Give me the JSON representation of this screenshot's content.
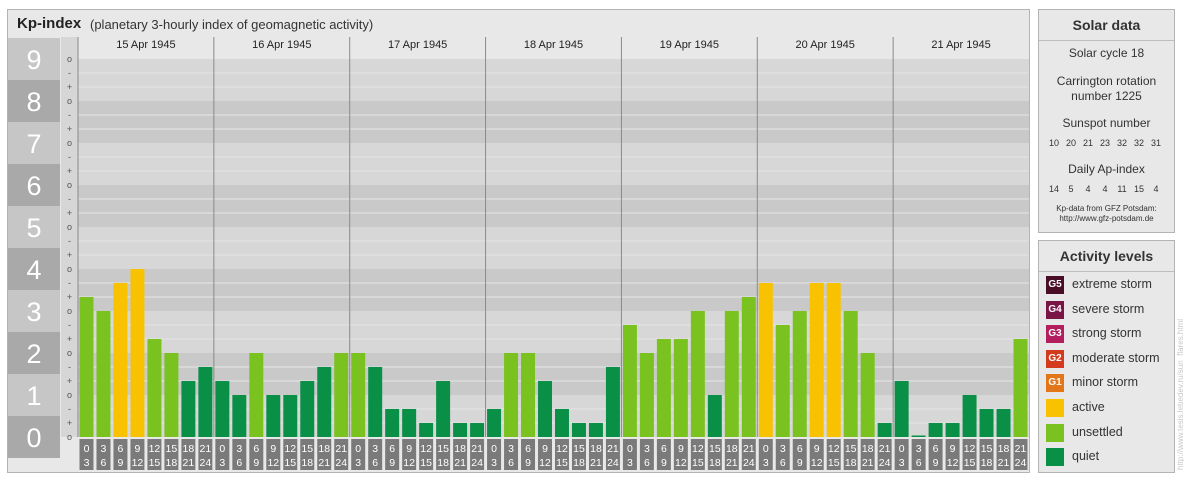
{
  "header": {
    "title": "Kp-index",
    "subtitle": "(planetary 3-hourly index of geomagnetic activity)"
  },
  "chart_data": {
    "type": "bar",
    "ylim": [
      0,
      9
    ],
    "ytick_labels": [
      "0",
      "1",
      "2",
      "3",
      "4",
      "5",
      "6",
      "7",
      "8",
      "9"
    ],
    "minor_tick_labels": [
      "o",
      "+",
      "-"
    ],
    "days": [
      "15 Apr 1945",
      "16 Apr 1945",
      "17 Apr 1945",
      "18 Apr 1945",
      "19 Apr 1945",
      "20 Apr 1945",
      "21 Apr 1945"
    ],
    "hour_labels": [
      [
        "0",
        "3"
      ],
      [
        "3",
        "6"
      ],
      [
        "6",
        "9"
      ],
      [
        "9",
        "12"
      ],
      [
        "12",
        "15"
      ],
      [
        "15",
        "18"
      ],
      [
        "18",
        "21"
      ],
      [
        "21",
        "24"
      ]
    ],
    "values": [
      3.333,
      3.0,
      3.667,
      4.0,
      2.333,
      2.0,
      1.333,
      1.667,
      1.333,
      1.0,
      2.0,
      1.0,
      1.0,
      1.333,
      1.667,
      2.0,
      2.0,
      1.667,
      0.667,
      0.667,
      0.333,
      1.333,
      0.333,
      0.333,
      0.667,
      2.0,
      2.0,
      1.333,
      0.667,
      0.333,
      0.333,
      1.667,
      2.667,
      2.0,
      2.333,
      2.333,
      3.0,
      1.0,
      3.0,
      3.333,
      3.667,
      2.667,
      3.0,
      3.667,
      3.667,
      3.0,
      2.0,
      0.333,
      1.333,
      0.0,
      0.333,
      0.333,
      1.0,
      0.667,
      0.667,
      2.333
    ],
    "level_colors": {
      "quiet": "#0a8f47",
      "unsettled": "#7ac21f",
      "active": "#f8c200"
    },
    "grid": true
  },
  "solar": {
    "title": "Solar data",
    "cycle": "Solar cycle 18",
    "carrington_line1": "Carrington rotation",
    "carrington_line2": "number 1225",
    "sunspot_label": "Sunspot number",
    "sunspot_values": [
      "10",
      "20",
      "21",
      "23",
      "32",
      "32",
      "31"
    ],
    "ap_label": "Daily Ap-index",
    "ap_values": [
      "14",
      "5",
      "4",
      "4",
      "11",
      "15",
      "4"
    ],
    "source_line1": "Kp-data from GFZ Potsdam:",
    "source_line2": "http://www.gfz-potsdam.de"
  },
  "activity": {
    "title": "Activity levels",
    "items": [
      {
        "code": "G5",
        "label": "extreme storm",
        "color": "#4a0d26"
      },
      {
        "code": "G4",
        "label": "severe storm",
        "color": "#7a1646"
      },
      {
        "code": "G3",
        "label": "strong storm",
        "color": "#b21e5e"
      },
      {
        "code": "G2",
        "label": "moderate storm",
        "color": "#d43a1c"
      },
      {
        "code": "G1",
        "label": "minor storm",
        "color": "#e4761a"
      },
      {
        "code": "",
        "label": "active",
        "color": "#f8c200"
      },
      {
        "code": "",
        "label": "unsettled",
        "color": "#7ac21f"
      },
      {
        "code": "",
        "label": "quiet",
        "color": "#0a8f47"
      }
    ]
  },
  "watermark": "http://www.tesis.lebedev.ru/sun_flares.html"
}
